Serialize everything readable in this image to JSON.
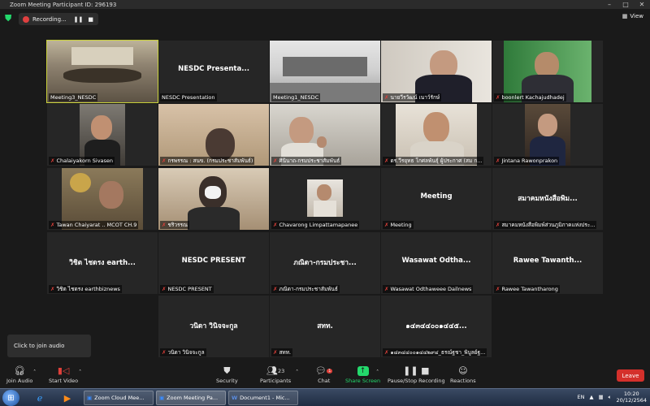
{
  "window": {
    "title": "Zoom Meeting Participant ID: 296193"
  },
  "topbar": {
    "recording_label": "Recording...",
    "pause_glyph": "❚❚",
    "stop_glyph": "■",
    "view_label": "View"
  },
  "tiles": [
    {
      "label": "Meeting3_NESDC",
      "big": "",
      "muted": false,
      "active": true
    },
    {
      "label": "NESDC Presentation",
      "big": "NESDC Presenta...",
      "muted": false,
      "active": false
    },
    {
      "label": "Meeting1_NESDC",
      "big": "",
      "muted": false,
      "active": false
    },
    {
      "label": "นายวีรวัฒน์ เนาว์รักษ์",
      "big": "",
      "muted": true,
      "active": false
    },
    {
      "label": "boonlert Kachajudhadej",
      "big": "",
      "muted": true,
      "active": false
    },
    {
      "label": "Chalaiyakorn Sivasen",
      "big": "",
      "muted": true,
      "active": false
    },
    {
      "label": "กรพรรณ : สนข. (กรมประชาสัมพันธ์)",
      "big": "",
      "muted": true,
      "active": false
    },
    {
      "label": "ศินินาถ-กรมประชาสัมพันธ์",
      "big": "",
      "muted": true,
      "active": false
    },
    {
      "label": "ดร.วีรยุทธ โกศลพันธุ์ ผู้ประกาศ (สม ก...",
      "big": "",
      "muted": true,
      "active": false
    },
    {
      "label": "Jintana Rawonprakon",
      "big": "",
      "muted": true,
      "active": false
    },
    {
      "label": "Tawan Chaiyarat .. MCOT CH.9",
      "big": "",
      "muted": true,
      "active": false
    },
    {
      "label": "ชริวรรณ",
      "big": "",
      "muted": true,
      "active": false
    },
    {
      "label": "Chavarong Limpattamapanee",
      "big": "",
      "muted": true,
      "active": false
    },
    {
      "label": "Meeting",
      "big": "Meeting",
      "muted": true,
      "active": false
    },
    {
      "label": "สมาคมหนังสือพิมพ์ส่วนภูมิภาคแห่งประ...",
      "big": "สมาคมหนังสือพิม...",
      "muted": true,
      "active": false
    },
    {
      "label": "วิชิต ไชดรง earthbiznews",
      "big": "วิชิต ไชดรง earth...",
      "muted": true,
      "active": false
    },
    {
      "label": "NESDC PRESENT",
      "big": "NESDC PRESENT",
      "muted": true,
      "active": false
    },
    {
      "label": "ภณิดา-กรมประชาสัมพันธ์",
      "big": "ภณิดา-กรมประชา...",
      "muted": true,
      "active": false
    },
    {
      "label": "Wasawat Odthaweee Dailnews",
      "big": "Wasawat Odtha...",
      "muted": true,
      "active": false
    },
    {
      "label": "Rawee Tawantharong",
      "big": "Rawee Tawanth...",
      "muted": true,
      "active": false
    },
    {
      "label": "วนิดา วินิจจะกูล",
      "big": "วนิดา วินิจจะกูล",
      "muted": true,
      "active": false
    },
    {
      "label": "สทท.",
      "big": "สทท.",
      "muted": true,
      "active": false
    },
    {
      "label": "๑๔๓๔๔๐๐๑๔๔๒๙๔_ธรณ์ฐชา_พิบูลย์ฐ...",
      "big": "๑๔๓๔๔๐๐๑๔๔๕...",
      "muted": true,
      "active": false
    }
  ],
  "tooltip": {
    "text": "Click to join audio"
  },
  "toolbar": {
    "join_audio": "Join Audio",
    "start_video": "Start Video",
    "security": "Security",
    "participants": "Participants",
    "participants_count": "23",
    "chat": "Chat",
    "chat_badge": "1",
    "share_screen": "Share Screen",
    "pause_stop_recording": "Pause/Stop Recording",
    "reactions": "Reactions",
    "leave": "Leave"
  },
  "taskbar": {
    "tasks": [
      "Zoom Cloud Mee...",
      "Zoom Meeting Pa...",
      "Document1 - Mic..."
    ],
    "lang": "EN",
    "time": "10:20",
    "date": "20/12/2564"
  },
  "colors": {
    "accent_green": "#23d96c",
    "leave_red": "#d4302b",
    "active_outline": "#c9d13a",
    "mic_muted": "#e0403a"
  }
}
